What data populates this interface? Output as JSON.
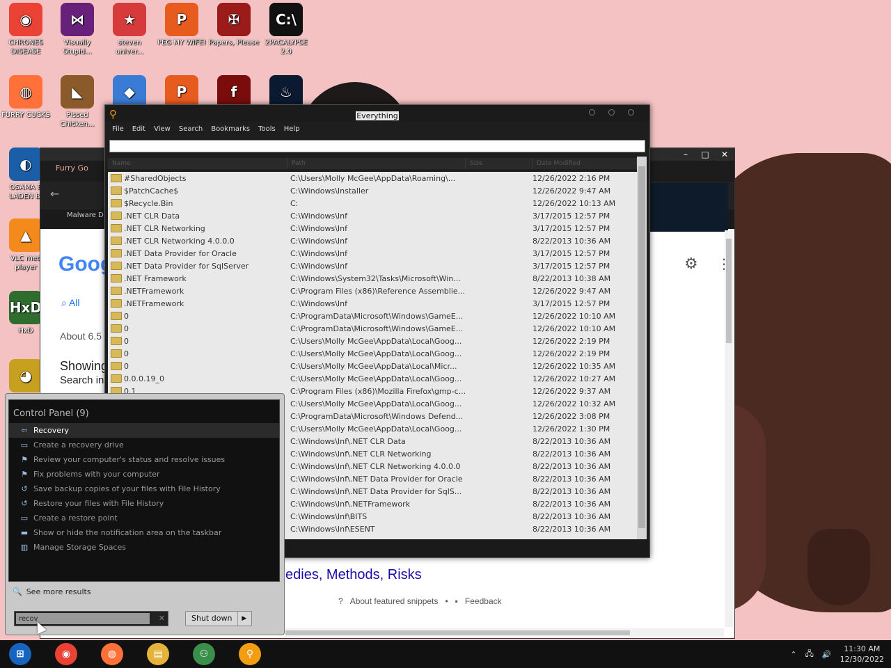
{
  "desktop_icons": [
    {
      "label": "CHRONES DISEASE",
      "icon": "chrome-icon",
      "color": "#ea4335"
    },
    {
      "label": "Visually Stupid...",
      "icon": "visual-studio-icon",
      "color": "#68217a"
    },
    {
      "label": "steven univer...",
      "icon": "steven-universe-icon",
      "color": "#d63a3a"
    },
    {
      "label": "PEG MY WIFE!",
      "icon": "peggle-icon",
      "color": "#e85b1e"
    },
    {
      "label": "Papers, Please",
      "icon": "papers-please-icon",
      "color": "#9b1b1b"
    },
    {
      "label": "2PACALYPSE 2.0",
      "icon": "cmd-icon",
      "color": "#111111"
    },
    {
      "label": "FURRY CUCKS",
      "icon": "firefox-icon",
      "color": "#ff7139"
    },
    {
      "label": "Pissed Chicken...",
      "icon": "angry-birds-icon",
      "color": "#8a5a2a"
    },
    {
      "label": "",
      "icon": "bejeweled-icon",
      "color": "#3a7bd5"
    },
    {
      "label": "",
      "icon": "peggle-icon",
      "color": "#e85b1e"
    },
    {
      "label": "",
      "icon": "flash-icon",
      "color": "#7a0c0c"
    },
    {
      "label": "",
      "icon": "blue-flame-icon",
      "color": "#0b1a30"
    },
    {
      "label": "OSAMA B LADEN BI",
      "icon": "obama-logo-icon",
      "color": "#1b5ea8"
    },
    {
      "label": "VLC med player",
      "icon": "vlc-icon",
      "color": "#f48a1c"
    },
    {
      "label": "HxD",
      "icon": "hxd-icon",
      "color": "#2f6d2f"
    },
    {
      "label": "",
      "icon": "game-icon",
      "color": "#c8a020"
    }
  ],
  "browser": {
    "tab_title": "Furry Go",
    "bookmark": "Malware D",
    "google_logo": "Goog",
    "tab_all": "All",
    "about": "About 6.5",
    "showing": "Showing",
    "search_in": "Search in",
    "link_text": "edies, Methods, Risks",
    "about_snippets": "About featured snippets",
    "feedback": "Feedback"
  },
  "everything": {
    "title": "Everything",
    "menu": [
      "File",
      "Edit",
      "View",
      "Search",
      "Bookmarks",
      "Tools",
      "Help"
    ],
    "search_value": "",
    "columns": [
      "Name",
      "Path",
      "Size",
      "Date Modified"
    ],
    "rows": [
      {
        "name": "#SharedObjects",
        "path": "C:\\Users\\Molly McGee\\AppData\\Roaming\\...",
        "date": "12/26/2022 2:16 PM"
      },
      {
        "name": "$PatchCache$",
        "path": "C:\\Windows\\Installer",
        "date": "12/26/2022 9:47 AM"
      },
      {
        "name": "$Recycle.Bin",
        "path": "C:",
        "date": "12/26/2022 10:13 AM"
      },
      {
        "name": ".NET CLR Data",
        "path": "C:\\Windows\\Inf",
        "date": "3/17/2015 12:57 PM"
      },
      {
        "name": ".NET CLR Networking",
        "path": "C:\\Windows\\Inf",
        "date": "3/17/2015 12:57 PM"
      },
      {
        "name": ".NET CLR Networking 4.0.0.0",
        "path": "C:\\Windows\\Inf",
        "date": "8/22/2013 10:36 AM"
      },
      {
        "name": ".NET Data Provider for Oracle",
        "path": "C:\\Windows\\Inf",
        "date": "3/17/2015 12:57 PM"
      },
      {
        "name": ".NET Data Provider for SqlServer",
        "path": "C:\\Windows\\Inf",
        "date": "3/17/2015 12:57 PM"
      },
      {
        "name": ".NET Framework",
        "path": "C:\\Windows\\System32\\Tasks\\Microsoft\\Win...",
        "date": "8/22/2013 10:38 AM"
      },
      {
        "name": ".NETFramework",
        "path": "C:\\Program Files (x86)\\Reference Assemblie...",
        "date": "12/26/2022 9:47 AM"
      },
      {
        "name": ".NETFramework",
        "path": "C:\\Windows\\Inf",
        "date": "3/17/2015 12:57 PM"
      },
      {
        "name": "0",
        "path": "C:\\ProgramData\\Microsoft\\Windows\\GameE...",
        "date": "12/26/2022 10:10 AM"
      },
      {
        "name": "0",
        "path": "C:\\ProgramData\\Microsoft\\Windows\\GameE...",
        "date": "12/26/2022 10:10 AM"
      },
      {
        "name": "0",
        "path": "C:\\Users\\Molly McGee\\AppData\\Local\\Goog...",
        "date": "12/26/2022 2:19 PM"
      },
      {
        "name": "0",
        "path": "C:\\Users\\Molly McGee\\AppData\\Local\\Goog...",
        "date": "12/26/2022 2:19 PM"
      },
      {
        "name": "0",
        "path": "C:\\Users\\Molly McGee\\AppData\\Local\\Micr...",
        "date": "12/26/2022 10:35 AM"
      },
      {
        "name": "0.0.0.19_0",
        "path": "C:\\Users\\Molly McGee\\AppData\\Local\\Goog...",
        "date": "12/26/2022 10:27 AM"
      },
      {
        "name": "0.1",
        "path": "C:\\Program Files (x86)\\Mozilla Firefox\\gmp-c...",
        "date": "12/26/2022 9:37 AM"
      },
      {
        "name": "",
        "path": "C:\\Users\\Molly McGee\\AppData\\Local\\Goog...",
        "date": "12/26/2022 10:32 AM"
      },
      {
        "name": "",
        "path": "C:\\ProgramData\\Microsoft\\Windows Defend...",
        "date": "12/26/2022 3:08 PM"
      },
      {
        "name": "",
        "path": "C:\\Users\\Molly McGee\\AppData\\Local\\Goog...",
        "date": "12/26/2022 1:30 PM"
      },
      {
        "name": "",
        "path": "C:\\Windows\\Inf\\.NET CLR Data",
        "date": "8/22/2013 10:36 AM"
      },
      {
        "name": "",
        "path": "C:\\Windows\\Inf\\.NET CLR Networking",
        "date": "8/22/2013 10:36 AM"
      },
      {
        "name": "",
        "path": "C:\\Windows\\Inf\\.NET CLR Networking 4.0.0.0",
        "date": "8/22/2013 10:36 AM"
      },
      {
        "name": "",
        "path": "C:\\Windows\\Inf\\.NET Data Provider for Oracle",
        "date": "8/22/2013 10:36 AM"
      },
      {
        "name": "",
        "path": "C:\\Windows\\Inf\\.NET Data Provider for SqlS...",
        "date": "8/22/2013 10:36 AM"
      },
      {
        "name": "",
        "path": "C:\\Windows\\Inf\\.NETFramework",
        "date": "8/22/2013 10:36 AM"
      },
      {
        "name": "",
        "path": "C:\\Windows\\Inf\\BITS",
        "date": "8/22/2013 10:36 AM"
      },
      {
        "name": "",
        "path": "C:\\Windows\\Inf\\ESENT",
        "date": "8/22/2013 10:36 AM"
      }
    ]
  },
  "start_menu": {
    "group_title": "Control Panel (9)",
    "items": [
      {
        "label": "Recovery",
        "icon": "recovery-icon"
      },
      {
        "label": "Create a recovery drive",
        "icon": "monitor-icon"
      },
      {
        "label": "Review your computer's status and resolve issues",
        "icon": "flag-icon"
      },
      {
        "label": "Fix problems with your computer",
        "icon": "flag-icon"
      },
      {
        "label": "Save backup copies of your files with File History",
        "icon": "file-history-icon"
      },
      {
        "label": "Restore your files with File History",
        "icon": "file-history-icon"
      },
      {
        "label": "Create a restore point",
        "icon": "monitor-icon"
      },
      {
        "label": "Show or hide the notification area on the taskbar",
        "icon": "taskbar-icon"
      },
      {
        "label": "Manage Storage Spaces",
        "icon": "storage-icon"
      }
    ],
    "see_more": "See more results",
    "search_value": "recov",
    "shutdown_label": "Shut down"
  },
  "taskbar": {
    "apps": [
      "start-orb-icon",
      "chrome-icon",
      "firefox-icon",
      "file-explorer-icon",
      "network-people-icon",
      "everything-search-icon"
    ],
    "time": "11:30 AM",
    "date": "12/30/2022"
  }
}
